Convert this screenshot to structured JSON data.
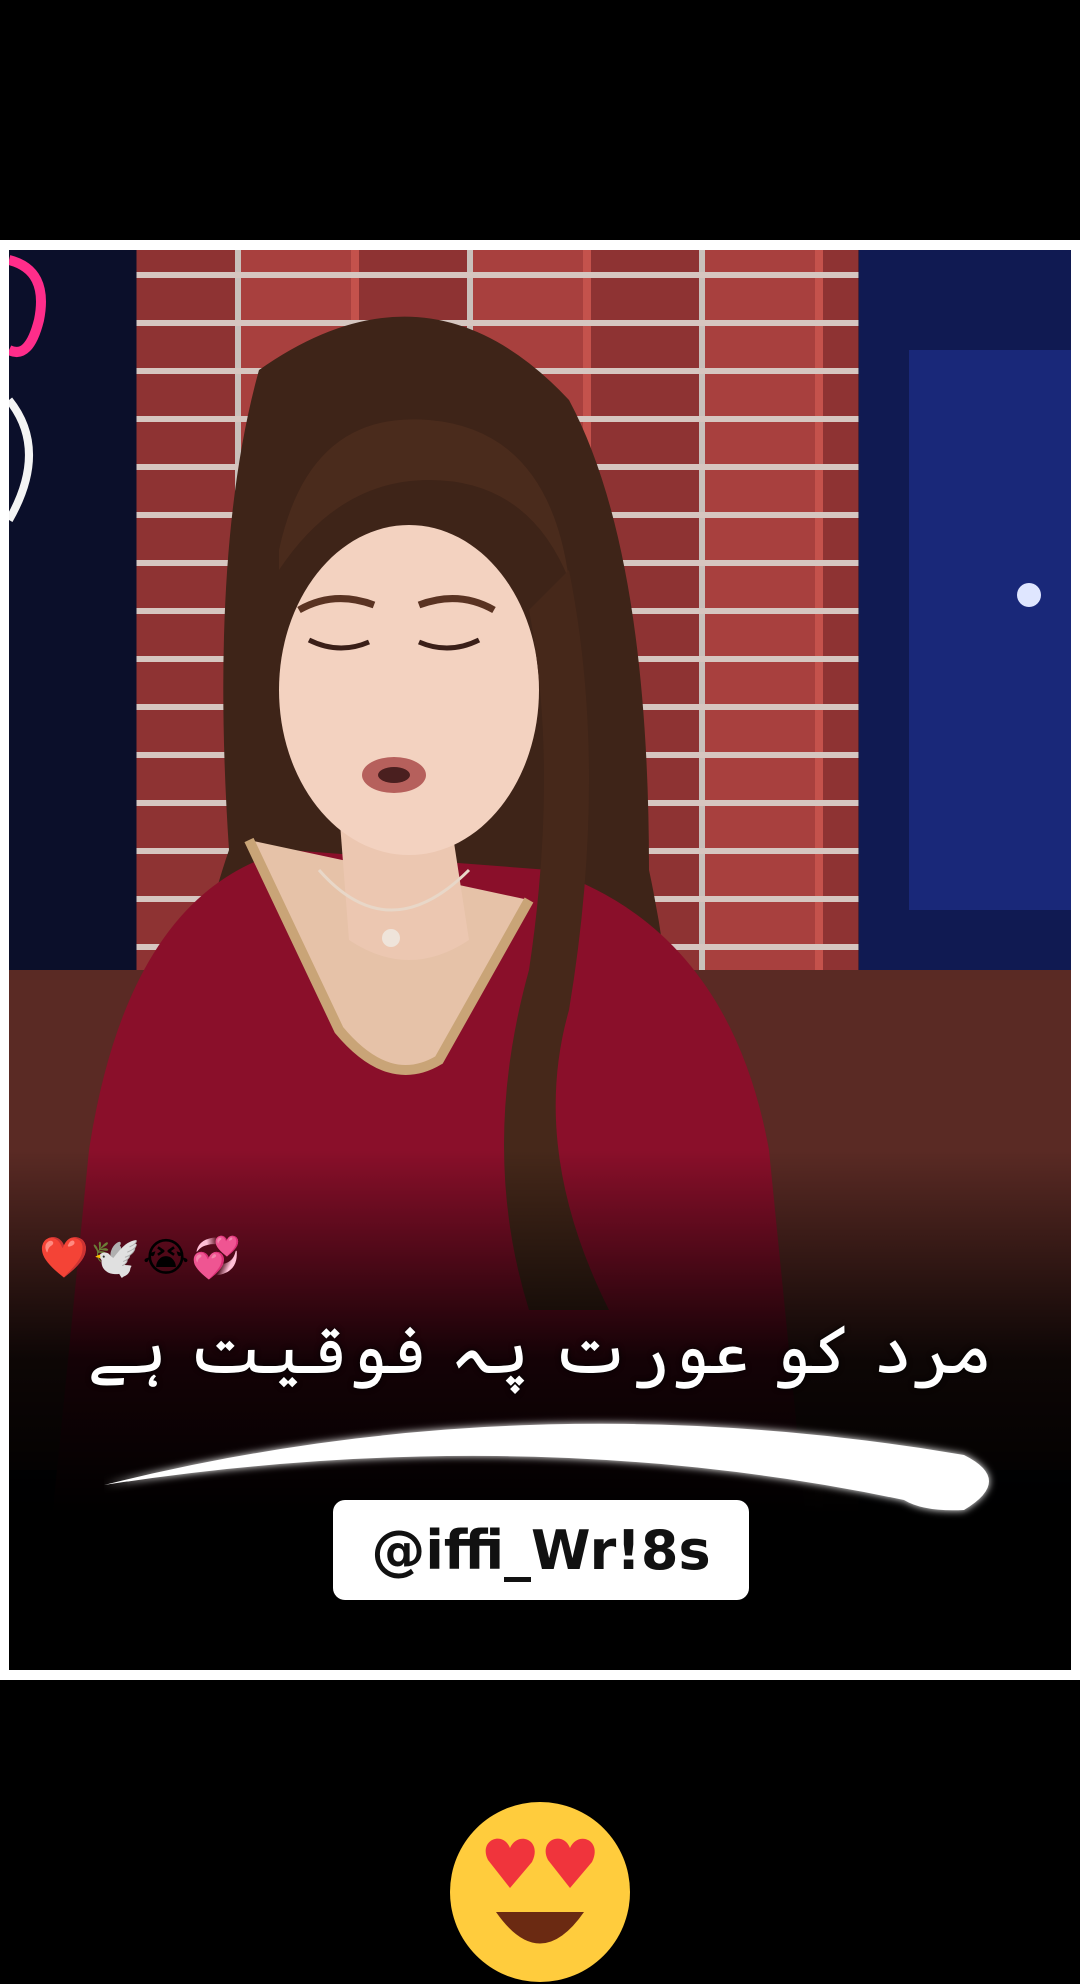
{
  "video": {
    "emoji_strip": "❤️🕊️😭💞",
    "caption_urdu": "مرد کو عورت پہ فوقیت ہے",
    "watermark_handle": "@iffi_Wr!8s"
  },
  "reaction_icon": "heart-eyes-emoji",
  "colors": {
    "background": "#000000",
    "frame": "#ffffff",
    "dress": "#8a0f2a",
    "wall_brick": "#b0443f"
  }
}
